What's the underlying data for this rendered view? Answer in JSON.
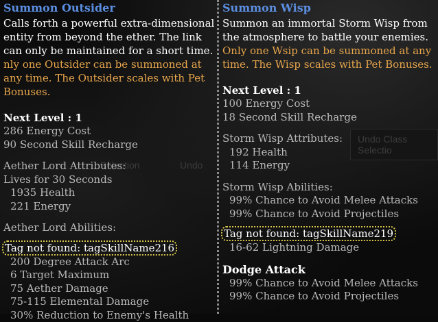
{
  "left": {
    "title": "Summon Outsider",
    "desc_white": "Calls forth a powerful extra-dimensional entity from beyond the ether.  The link can only be maintained for a short time.",
    "desc_orange": "nly one Outsider can be summoned at any time. The Outsider scales with Pet Bonuses.",
    "next_level": "Next Level : 1",
    "energy_cost": "286 Energy Cost",
    "recharge": "90 Second Skill Recharge",
    "attributes_header": "Aether Lord Attributes:",
    "lives": "Lives for 30 Seconds",
    "health": "1935  Health",
    "energy": "221  Energy",
    "abilities_header": "Aether Lord Abilities:",
    "tag": "Tag not found: tagSkillName216",
    "ability_lines": [
      "200 Degree Attack Arc",
      "6 Target Maximum",
      "75 Aether Damage",
      "75-115 Elemental Damage",
      "30% Reduction to Enemy's Health"
    ]
  },
  "right": {
    "title": "Summon Wisp",
    "desc_white": "Summon an immortal Storm Wisp from the atmosphere to battle your enemies.",
    "desc_orange": "Only one Wsip can be summoned at any time. The Wisp scales with Pet Bonuses.",
    "next_level": "Next Level : 1",
    "energy_cost": "100 Energy Cost",
    "recharge": "18 Second Skill Recharge",
    "attributes_header": "Storm Wisp Attributes:",
    "health": "192  Health",
    "energy": "114  Energy",
    "abilities_header": "Storm Wisp Abilities:",
    "ability_lines": [
      "99% Chance to Avoid Melee Attacks",
      "99% Chance to Avoid Projectiles"
    ],
    "tag": "Tag not found: tagSkillName219",
    "tag_line": "16-62 Lightning Damage",
    "dodge_header": "Dodge Attack",
    "dodge_lines": [
      "99% Chance to Avoid Melee Attacks",
      "99% Chance to Avoid Projectiles"
    ]
  },
  "background": {
    "undo_class_selection": "Undo Class Selectio",
    "selection": "Selection",
    "undo": "Undo"
  }
}
